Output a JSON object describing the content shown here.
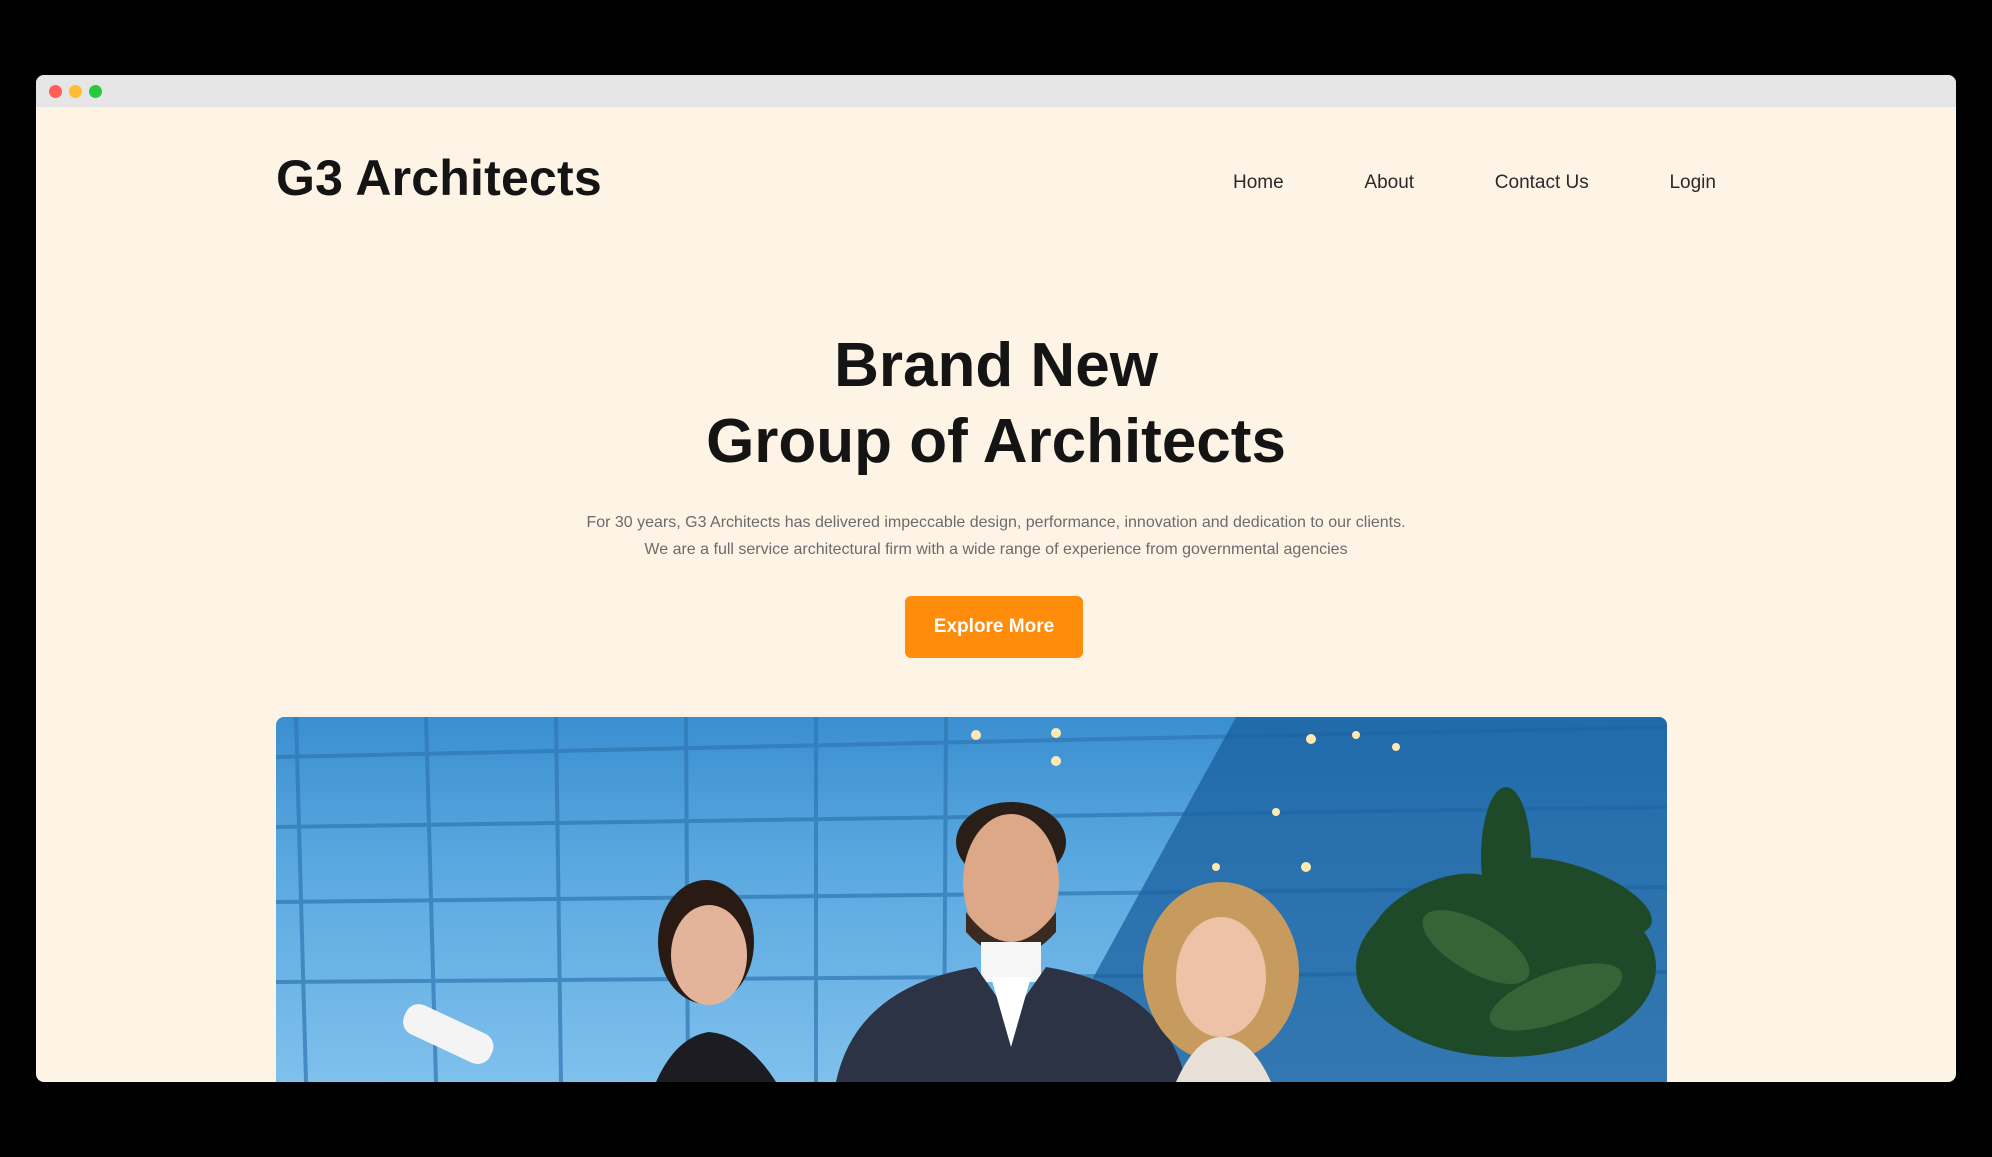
{
  "site": {
    "brand": "G3 Architects"
  },
  "nav": {
    "items": [
      {
        "label": "Home"
      },
      {
        "label": "About"
      },
      {
        "label": "Contact Us"
      },
      {
        "label": "Login"
      }
    ]
  },
  "hero": {
    "title_line1": "Brand New",
    "title_line2": "Group of Architects",
    "subtitle_line1": "For 30 years, G3 Architects has delivered impeccable design, performance, innovation and dedication to our clients.",
    "subtitle_line2": "We are a full service architectural firm with a wide range of experience from governmental agencies",
    "cta_label": "Explore More"
  },
  "colors": {
    "page_background": "#fef4e6",
    "accent": "#ff8c0b",
    "text_dark": "#141414",
    "text_muted": "#6b6b6b"
  },
  "hero_image": {
    "description_icon": "team-photo"
  }
}
